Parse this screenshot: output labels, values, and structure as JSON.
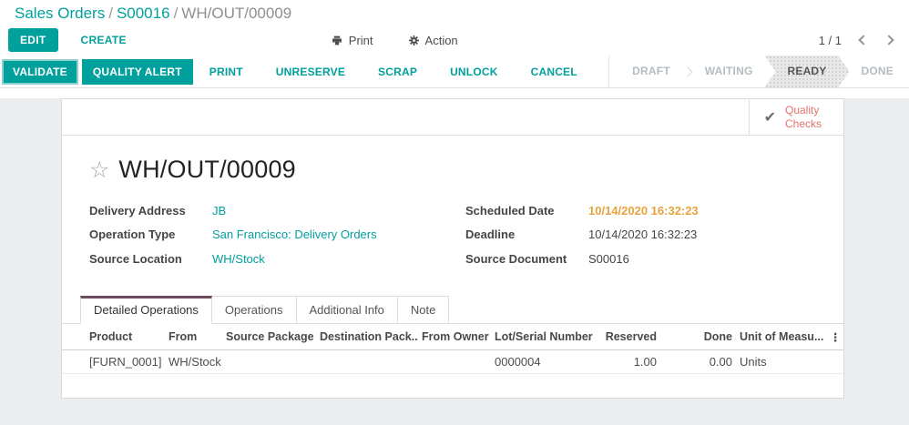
{
  "breadcrumb": {
    "links": [
      "Sales Orders",
      "S00016"
    ],
    "separator": "/",
    "current": "WH/OUT/00009"
  },
  "control_panel": {
    "edit_label": "EDIT",
    "create_label": "CREATE",
    "print_label": "Print",
    "action_label": "Action",
    "pager_value": "1 / 1"
  },
  "statusbar": {
    "primary_buttons": [
      {
        "label": "VALIDATE"
      },
      {
        "label": "QUALITY ALERT"
      }
    ],
    "flat_buttons": [
      {
        "label": "PRINT"
      },
      {
        "label": "UNRESERVE"
      },
      {
        "label": "SCRAP"
      },
      {
        "label": "UNLOCK"
      },
      {
        "label": "CANCEL"
      }
    ],
    "states": [
      {
        "label": "DRAFT",
        "active": false
      },
      {
        "label": "WAITING",
        "active": false
      },
      {
        "label": "READY",
        "active": true
      },
      {
        "label": "DONE",
        "active": false
      }
    ]
  },
  "sheet": {
    "button_box": {
      "quality_checks_label": "Quality Checks",
      "icon": "check-icon"
    },
    "title": "WH/OUT/00009",
    "fields": {
      "left": [
        {
          "label": "Delivery Address",
          "value": "JB",
          "type": "link"
        },
        {
          "label": "Operation Type",
          "value": "San Francisco: Delivery Orders",
          "type": "link"
        },
        {
          "label": "Source Location",
          "value": "WH/Stock",
          "type": "link"
        }
      ],
      "right": [
        {
          "label": "Scheduled Date",
          "value": "10/14/2020 16:32:23",
          "type": "warning"
        },
        {
          "label": "Deadline",
          "value": "10/14/2020 16:32:23",
          "type": "text"
        },
        {
          "label": "Source Document",
          "value": "S00016",
          "type": "text"
        }
      ]
    },
    "tabs": [
      {
        "label": "Detailed Operations",
        "active": true
      },
      {
        "label": "Operations",
        "active": false
      },
      {
        "label": "Additional Info",
        "active": false
      },
      {
        "label": "Note",
        "active": false
      }
    ],
    "table": {
      "columns": [
        "Product",
        "From",
        "Source Package",
        "Destination Pack...",
        "From Owner",
        "Lot/Serial Number",
        "Reserved",
        "Done",
        "Unit of Measu..."
      ],
      "kebab_icon": "column-options-icon",
      "rows": [
        {
          "product": "[FURN_0001] ...",
          "from": "WH/Stock",
          "source_package": "",
          "destination_package": "",
          "from_owner": "",
          "lot_serial": "0000004",
          "reserved": "1.00",
          "done": "0.00",
          "uom": "Units"
        }
      ]
    }
  },
  "colors": {
    "accent_teal": "#00A09D",
    "warning_orange": "#E8A33D",
    "quality_red": "#E2726B",
    "active_tab_border": "#6E4B5E"
  }
}
